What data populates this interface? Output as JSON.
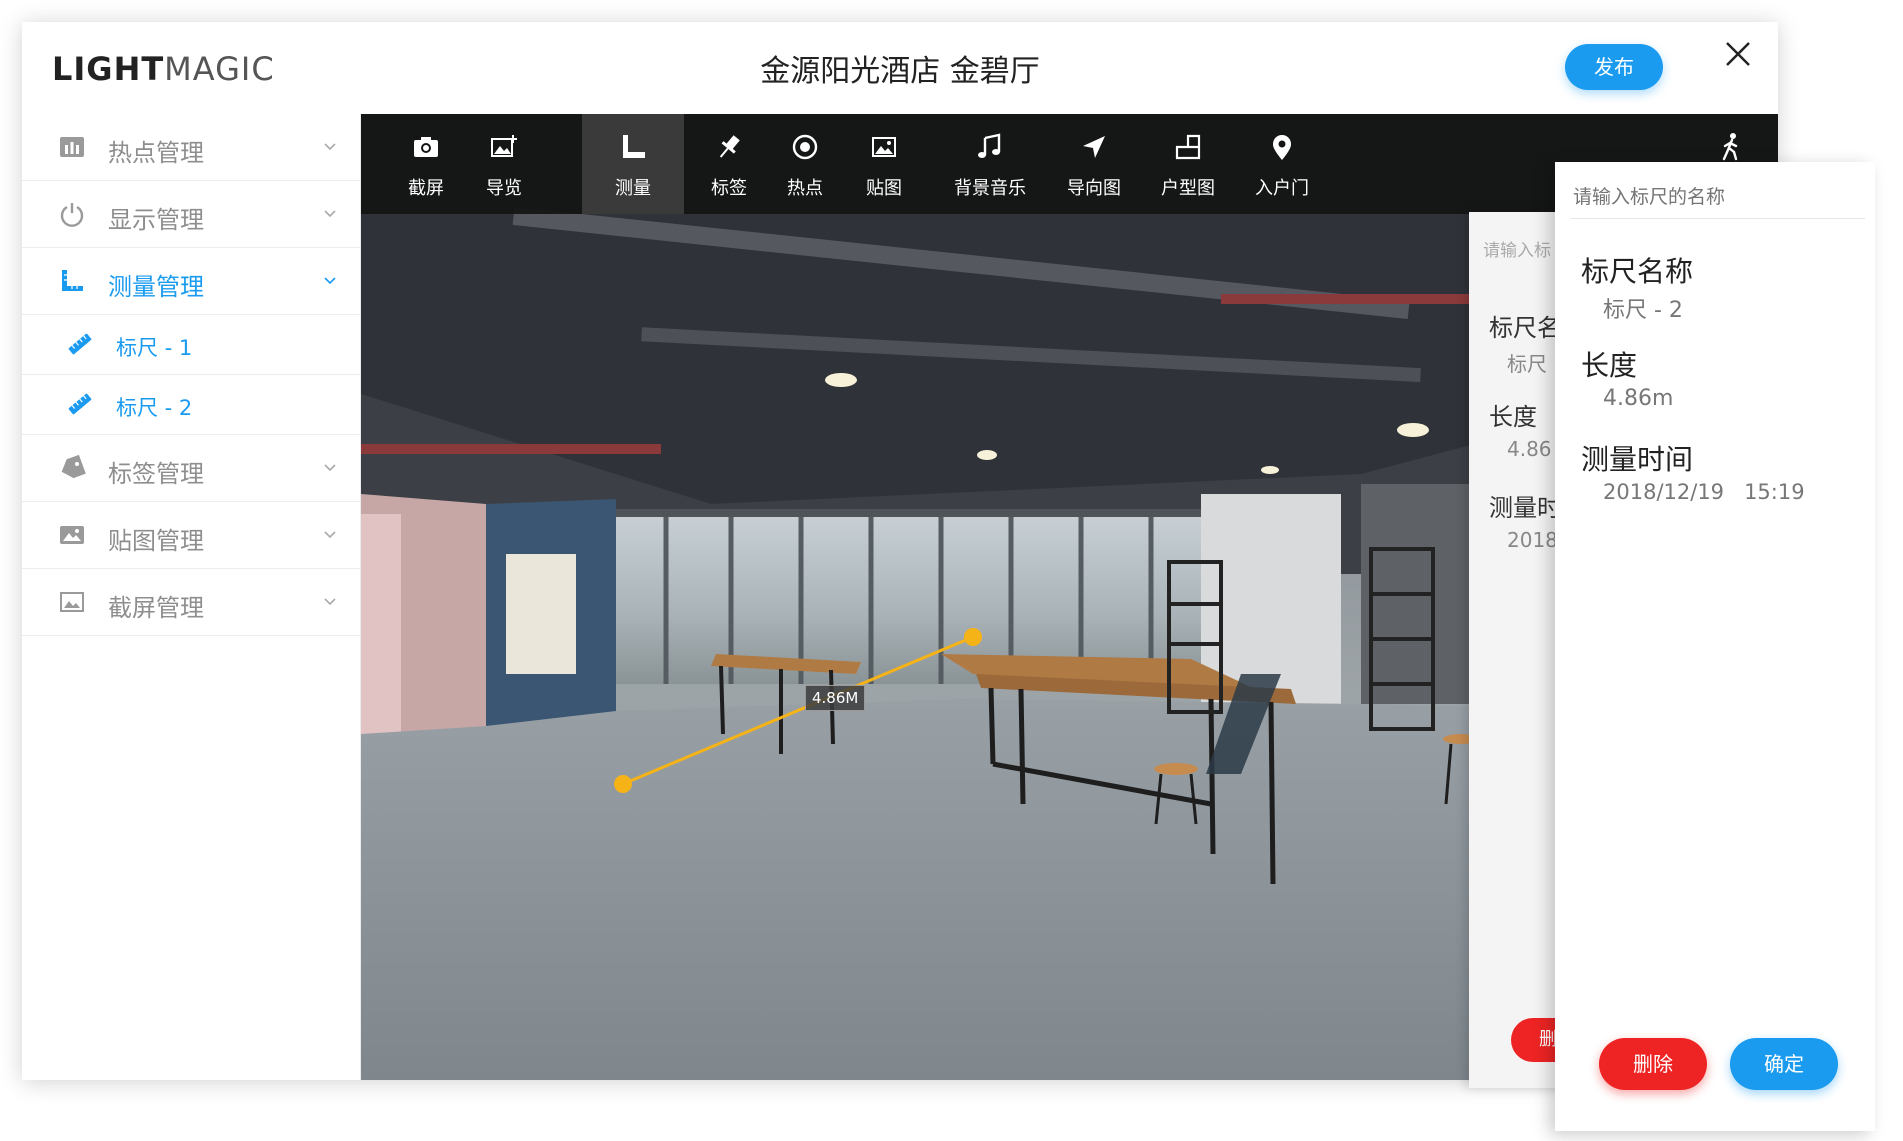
{
  "header": {
    "logo_bold": "LIGHT",
    "logo_light": "MAGIC",
    "title": "金源阳光酒店 金碧厅",
    "publish_label": "发布"
  },
  "sidebar": {
    "items": [
      {
        "label": "热点管理",
        "icon": "bar-chart-icon"
      },
      {
        "label": "显示管理",
        "icon": "power-icon"
      },
      {
        "label": "测量管理",
        "icon": "ruler-angle-icon"
      },
      {
        "label": "标签管理",
        "icon": "tag-icon"
      },
      {
        "label": "贴图管理",
        "icon": "image-icon"
      },
      {
        "label": "截屏管理",
        "icon": "picture-icon"
      }
    ],
    "sub_items": [
      {
        "label": "标尺 - 1",
        "icon": "ruler-icon"
      },
      {
        "label": "标尺 - 2",
        "icon": "ruler-icon"
      }
    ]
  },
  "toolbar": {
    "tools": [
      {
        "label": "截屏",
        "icon": "camera-icon"
      },
      {
        "label": "导览",
        "icon": "image-add-icon"
      },
      {
        "label": "测量",
        "icon": "ruler-angle-icon"
      },
      {
        "label": "标签",
        "icon": "pin-icon"
      },
      {
        "label": "热点",
        "icon": "target-icon"
      },
      {
        "label": "贴图",
        "icon": "sticker-image-icon"
      },
      {
        "label": "背景音乐",
        "icon": "music-icon"
      },
      {
        "label": "导向图",
        "icon": "navigation-arrow-icon"
      },
      {
        "label": "户型图",
        "icon": "floorplan-icon"
      },
      {
        "label": "入户门",
        "icon": "location-pin-icon"
      }
    ],
    "walk_icon": "walking-person-icon"
  },
  "viewer": {
    "measurement_label": "4.86M"
  },
  "back_panel": {
    "placeholder": "请输入标",
    "name_label": "标尺名",
    "name_value": "标尺",
    "length_label": "长度",
    "length_value": "4.86",
    "time_label": "测量时",
    "time_value": "2018",
    "delete_label": "删"
  },
  "ruler_panel": {
    "name_placeholder": "请输入标尺的名称",
    "name_label": "标尺名称",
    "name_value": "标尺 - 2",
    "length_label": "长度",
    "length_value": "4.86m",
    "time_label": "测量时间",
    "time_value": "2018/12/19   15:19",
    "delete_label": "删除",
    "confirm_label": "确定"
  },
  "colors": {
    "accent": "#1a9bf0",
    "danger": "#ee2424",
    "measure_line": "#f6b318"
  }
}
